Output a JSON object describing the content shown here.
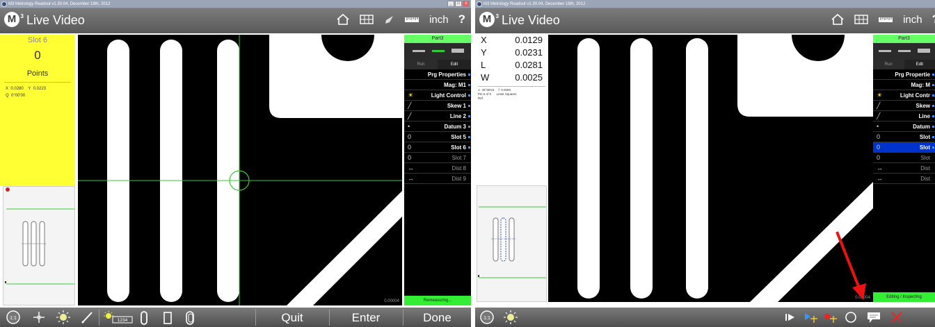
{
  "left": {
    "titlebar": "M3 Metrology Readout  v1.30.04, December 18th, 2012",
    "screen_title": "Live Video",
    "logo": "M",
    "logo_sup": "3",
    "unit": "inch",
    "help": "?",
    "yellow": {
      "title": "Slot 6",
      "count": "0",
      "points_label": "Points",
      "x_label": "X",
      "x_value": "0.0280",
      "y_label": "Y",
      "y_value": "0.0223",
      "q_label": "Q",
      "q_value": "0°00'00"
    },
    "video_readout": "0.00004",
    "panel": {
      "part": "Part3",
      "tab_run": "Run",
      "tab_edit": "Edit",
      "rows": [
        {
          "label": "Prg Properties",
          "icon": "",
          "state": "normal"
        },
        {
          "label": "Mag: M1",
          "icon": "",
          "state": "normal"
        },
        {
          "label": "Light Control",
          "icon": "☀",
          "state": "normal"
        },
        {
          "label": "Skew 1",
          "icon": "╱",
          "state": "normal"
        },
        {
          "label": "Line 2",
          "icon": "╱",
          "state": "normal"
        },
        {
          "label": "Datum 3",
          "icon": "•",
          "state": "normal"
        },
        {
          "label": "Slot 5",
          "icon": "0",
          "state": "normal"
        },
        {
          "label": "Slot 6",
          "icon": "0",
          "state": "normal"
        },
        {
          "label": "Slot 7",
          "icon": "0",
          "state": "dim"
        },
        {
          "label": "Dist 8",
          "icon": "↔",
          "state": "dim"
        },
        {
          "label": "Dist 9",
          "icon": "↔",
          "state": "dim"
        }
      ],
      "status": "Remeasuring..."
    },
    "toolbar": {
      "quit": "Quit",
      "enter": "Enter",
      "done": "Done",
      "mag": "1:1",
      "counter": "1234"
    }
  },
  "right": {
    "titlebar": "M3 Metrology Readout  v1.30.04, December 18th, 2012",
    "screen_title": "Live Video",
    "logo": "M",
    "logo_sup": "3",
    "unit": "inch",
    "help": "?",
    "dro": [
      {
        "axis": "X",
        "value": "0.0129"
      },
      {
        "axis": "Y",
        "value": "0.0231"
      },
      {
        "axis": "L",
        "value": "0.0281"
      },
      {
        "axis": "W",
        "value": "0.0025"
      }
    ],
    "dro_small": {
      "a_label": "A",
      "a_value": "45°55'53",
      "f_label": "f",
      "f_value": "0.0000",
      "pts": "Pts 6 of 6",
      "method": "Least Squares",
      "ref": "Ref"
    },
    "video_readout": "0.00004",
    "panel": {
      "part": "Part3",
      "tab_run": "Run",
      "tab_edit": "Edit",
      "rows": [
        {
          "label": "Prg Propertie",
          "icon": "",
          "state": "normal"
        },
        {
          "label": "Mag: M",
          "icon": "",
          "state": "normal"
        },
        {
          "label": "Light Contr",
          "icon": "☀",
          "state": "normal"
        },
        {
          "label": "Skew",
          "icon": "╱",
          "state": "normal"
        },
        {
          "label": "Line",
          "icon": "╱",
          "state": "normal"
        },
        {
          "label": "Datum",
          "icon": "•",
          "state": "normal"
        },
        {
          "label": "Slot",
          "icon": "0",
          "state": "normal"
        },
        {
          "label": "Slot",
          "icon": "0",
          "state": "selected"
        },
        {
          "label": "Slot",
          "icon": "0",
          "state": "dim"
        },
        {
          "label": "Dist",
          "icon": "↔",
          "state": "dim"
        },
        {
          "label": "Dist",
          "icon": "↔",
          "state": "dim"
        }
      ],
      "status": "Editing / Inspecting"
    },
    "toolbar": {
      "mag": "1:1"
    }
  },
  "colors": {
    "yellow_panel": "#ffff33",
    "green_status": "#33ee33",
    "selected_row": "#0033cc",
    "crosshair": "#33cc33",
    "annotation_arrow": "#ee1111"
  }
}
